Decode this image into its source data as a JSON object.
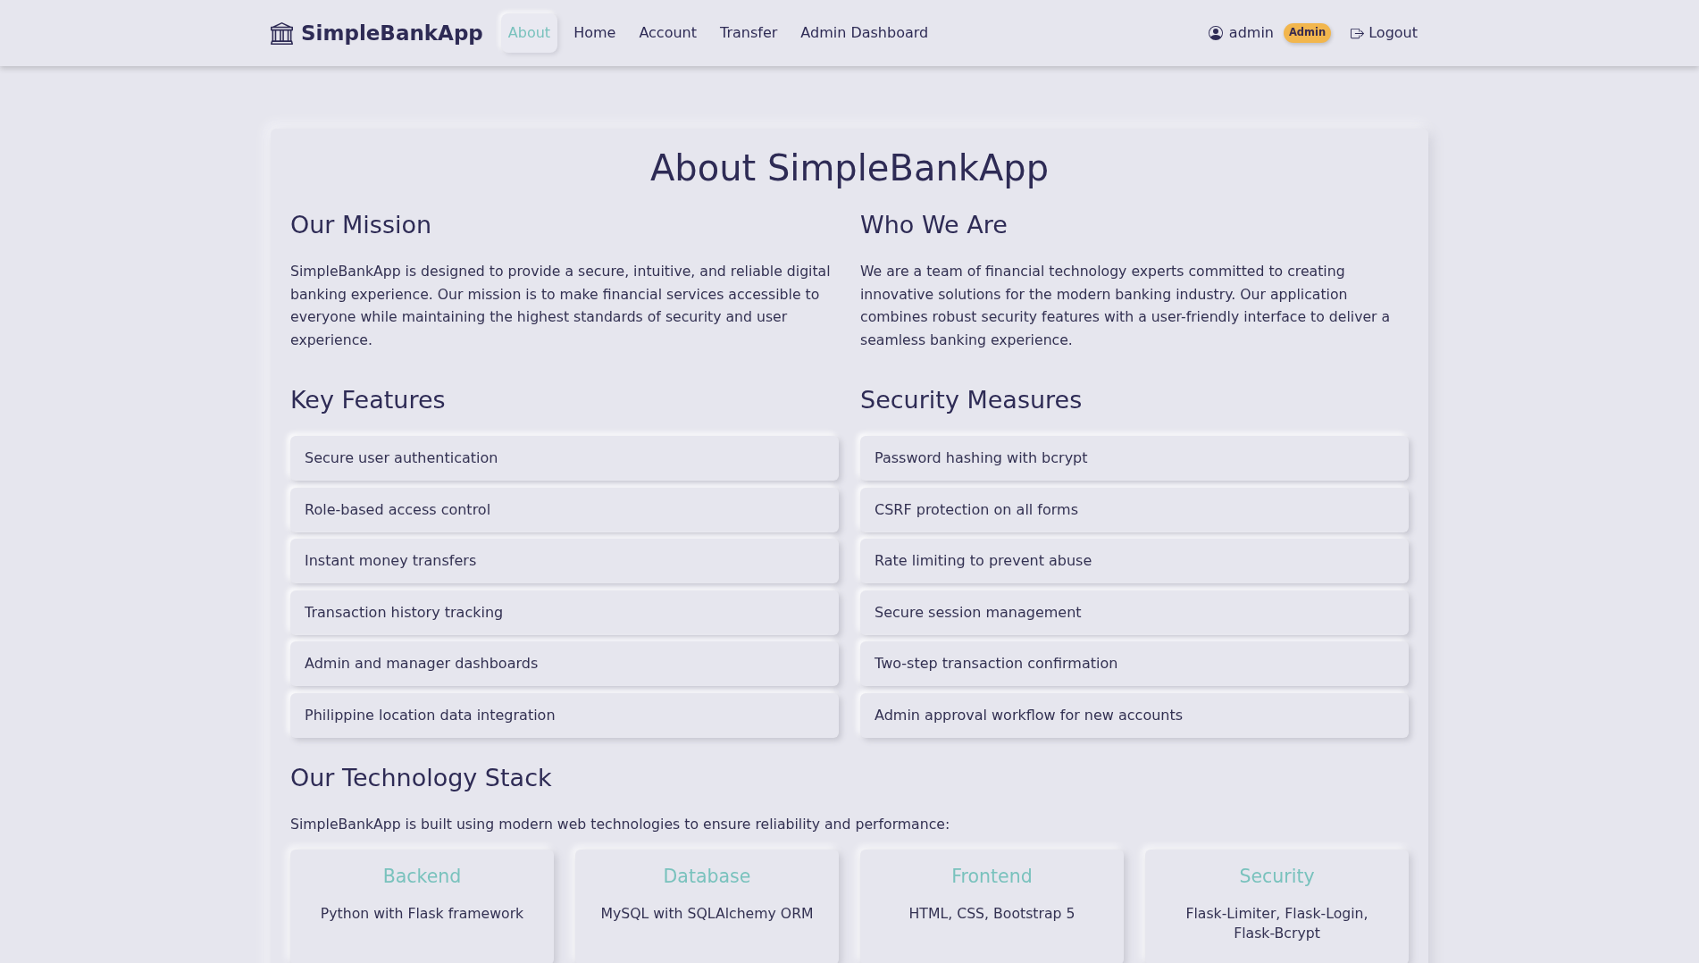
{
  "navbar": {
    "brand": "SimpleBankApp",
    "links": [
      {
        "label": "About",
        "selected": true
      },
      {
        "label": "Home",
        "selected": false
      },
      {
        "label": "Account",
        "selected": false
      },
      {
        "label": "Transfer",
        "selected": false
      },
      {
        "label": "Admin Dashboard",
        "selected": false
      }
    ],
    "user": {
      "name": "admin",
      "badge": "Admin"
    },
    "logout": "Logout"
  },
  "about": {
    "title": "About SimpleBankApp",
    "intro_sections": [
      {
        "heading": "Our Mission",
        "text": "SimpleBankApp is designed to provide a secure, intuitive, and reliable digital banking experience. Our mission is to make financial services accessible to everyone while maintaining the highest standards of security and user experience."
      },
      {
        "heading": "Who We Are",
        "text": "We are a team of financial technology experts committed to creating innovative solutions for the modern banking industry. Our application combines robust security features with a user-friendly interface to deliver a seamless banking experience."
      }
    ],
    "list_sections": [
      {
        "heading": "Key Features",
        "items": [
          "Secure user authentication",
          "Role-based access control",
          "Instant money transfers",
          "Transaction history tracking",
          "Admin and manager dashboards",
          "Philippine location data integration"
        ]
      },
      {
        "heading": "Security Measures",
        "items": [
          "Password hashing with bcrypt",
          "CSRF protection on all forms",
          "Rate limiting to prevent abuse",
          "Secure session management",
          "Two-step transaction confirmation",
          "Admin approval workflow for new accounts"
        ]
      }
    ],
    "technology": {
      "heading": "Our Technology Stack",
      "text": "SimpleBankApp is built using modern web technologies to ensure reliability and performance:",
      "cards": [
        {
          "title": "Backend",
          "text": "Python with Flask framework"
        },
        {
          "title": "Database",
          "text": "MySQL with SQLAlchemy ORM"
        },
        {
          "title": "Frontend",
          "text": "HTML, CSS, Bootstrap 5"
        },
        {
          "title": "Security",
          "text": "Flask-Limiter, Flask-Login, Flask-Bcrypt"
        }
      ]
    }
  }
}
